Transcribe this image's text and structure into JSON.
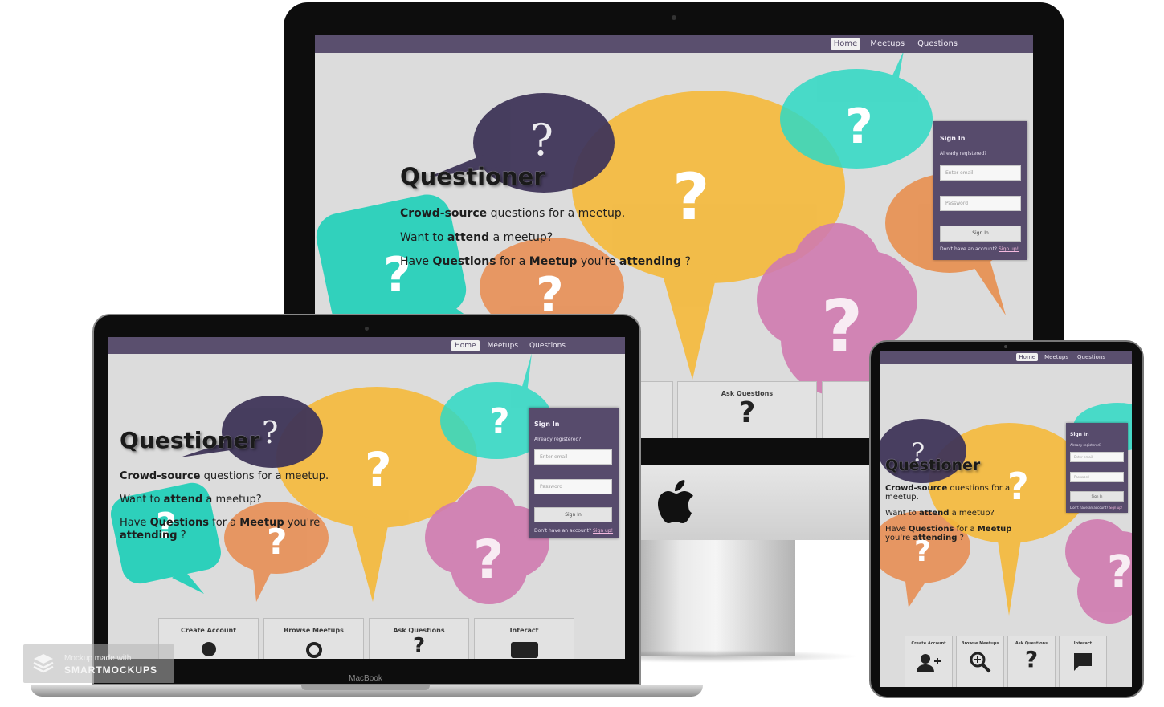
{
  "nav": {
    "items": [
      {
        "label": "Home",
        "active": true
      },
      {
        "label": "Meetups",
        "active": false
      },
      {
        "label": "Questions",
        "active": false
      }
    ]
  },
  "hero": {
    "title": "Questioner",
    "line1_bold": "Crowd-source",
    "line1_rest": " questions for a meetup.",
    "line2_pre": "Want to ",
    "line2_bold": "attend",
    "line2_post": " a meetup?",
    "line3_pre": "Have ",
    "line3_bold1": "Questions",
    "line3_mid": " for a ",
    "line3_bold2": "Meetup",
    "line3_mid2": " you're ",
    "line3_bold3": "attending",
    "line3_post": " ?",
    "bubble_mark": "?"
  },
  "signin": {
    "title": "Sign In",
    "subtitle": "Already registered?",
    "email_placeholder": "Enter email",
    "password_placeholder": "Password",
    "button": "Sign In",
    "footer_text": "Don't have an account?",
    "footer_link": "Sign up!"
  },
  "cards": [
    {
      "label": "Create Account",
      "icon": "add-user-icon"
    },
    {
      "label": "Browse Meetups",
      "icon": "zoom-icon"
    },
    {
      "label": "Ask Questions",
      "icon": "question-icon"
    },
    {
      "label": "Interact",
      "icon": "chat-icon"
    }
  ],
  "device": {
    "laptop_brand": "MacBook"
  },
  "watermark": {
    "line1": "Mockup made with",
    "line2": "SMARTMOCKUPS"
  },
  "colors": {
    "nav": "#5a4f6e",
    "signin": "#574b6c",
    "bubble_purple": "#3f3558",
    "bubble_yellow": "#f5b93a",
    "bubble_teal": "#2dd4bf",
    "bubble_orange": "#e58f4e",
    "bubble_pink": "#d17ab0"
  }
}
